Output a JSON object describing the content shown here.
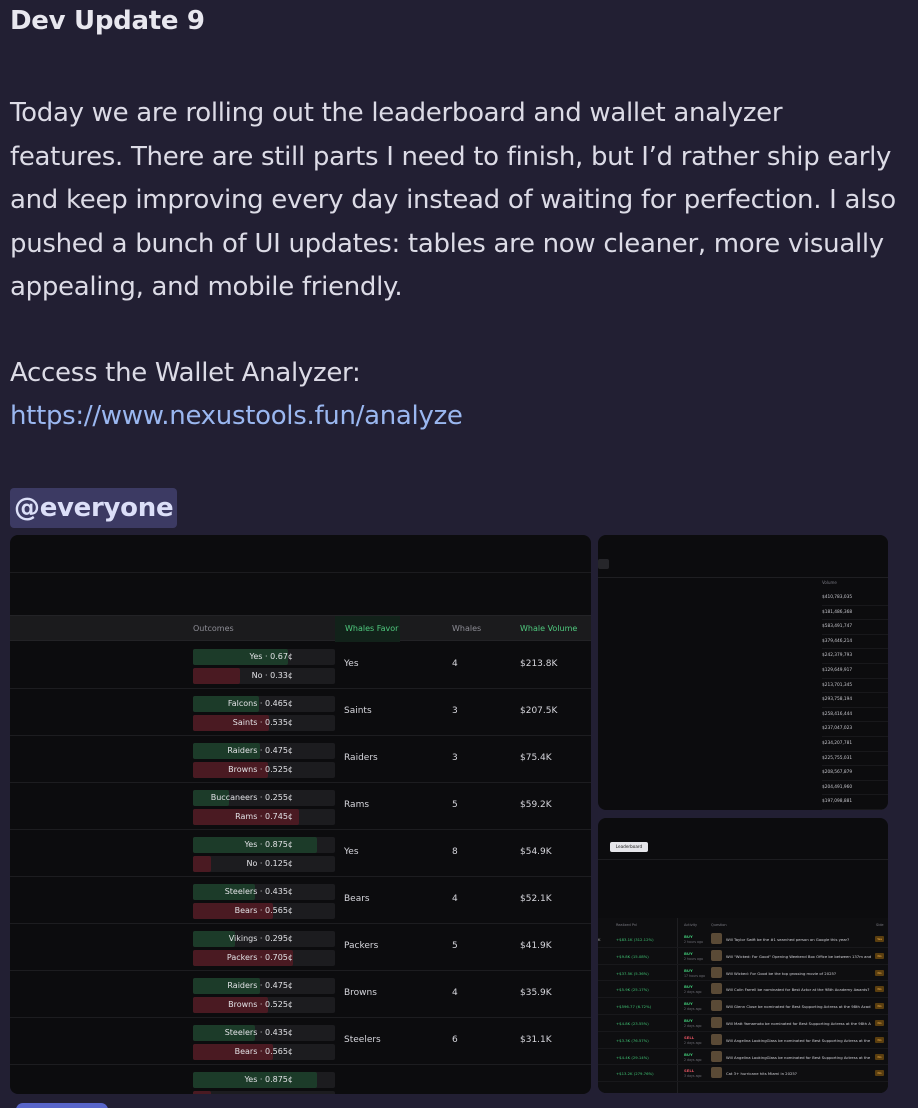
{
  "post": {
    "title": "Dev Update 9",
    "body": "Today we are rolling out the leaderboard and wallet analyzer features. There are still parts I need to finish, but I’d rather ship early and keep improving every day instead of waiting for perfection. I also pushed a bunch of UI updates: tables are now cleaner, more visually appealing, and mobile friendly.",
    "access_label": "Access the Wallet Analyzer:",
    "link": "https://www.nexustools.fun/analyze",
    "mention": "@everyone"
  },
  "colors": {
    "background": "#221f33",
    "link": "#9ab7f0",
    "mention_bg": "#3c3a63",
    "positive": "#4fc97e",
    "negative": "#e0525f"
  },
  "main_table": {
    "headers": {
      "outcomes": "Outcomes",
      "whales_favor": "Whales Favor",
      "whales": "Whales",
      "whale_volume": "Whale Volume"
    },
    "rows": [
      {
        "yes_label": "Yes · 0.67¢",
        "yes_share": 0.67,
        "no_label": "No · 0.33¢",
        "no_share": 0.33,
        "favor": "Yes",
        "whales": "4",
        "volume": "$213.8K"
      },
      {
        "yes_label": "Falcons · 0.465¢",
        "yes_share": 0.465,
        "no_label": "Saints · 0.535¢",
        "no_share": 0.535,
        "favor": "Saints",
        "whales": "3",
        "volume": "$207.5K"
      },
      {
        "yes_label": "Raiders · 0.475¢",
        "yes_share": 0.475,
        "no_label": "Browns · 0.525¢",
        "no_share": 0.525,
        "favor": "Raiders",
        "whales": "3",
        "volume": "$75.4K"
      },
      {
        "yes_label": "Buccaneers · 0.255¢",
        "yes_share": 0.255,
        "no_label": "Rams · 0.745¢",
        "no_share": 0.745,
        "favor": "Rams",
        "whales": "5",
        "volume": "$59.2K"
      },
      {
        "yes_label": "Yes · 0.875¢",
        "yes_share": 0.875,
        "no_label": "No · 0.125¢",
        "no_share": 0.125,
        "favor": "Yes",
        "whales": "8",
        "volume": "$54.9K"
      },
      {
        "yes_label": "Steelers · 0.435¢",
        "yes_share": 0.435,
        "no_label": "Bears · 0.565¢",
        "no_share": 0.565,
        "favor": "Bears",
        "whales": "4",
        "volume": "$52.1K"
      },
      {
        "yes_label": "Vikings · 0.295¢",
        "yes_share": 0.295,
        "no_label": "Packers · 0.705¢",
        "no_share": 0.705,
        "favor": "Packers",
        "whales": "5",
        "volume": "$41.9K"
      },
      {
        "yes_label": "Raiders · 0.475¢",
        "yes_share": 0.475,
        "no_label": "Browns · 0.525¢",
        "no_share": 0.525,
        "favor": "Browns",
        "whales": "4",
        "volume": "$35.9K"
      },
      {
        "yes_label": "Steelers · 0.435¢",
        "yes_share": 0.435,
        "no_label": "Bears · 0.565¢",
        "no_share": 0.565,
        "favor": "Steelers",
        "whales": "6",
        "volume": "$31.1K"
      },
      {
        "yes_label": "Yes · 0.875¢",
        "yes_share": 0.875,
        "no_label": "",
        "no_share": 0.125,
        "favor": "",
        "whales": "",
        "volume": ""
      }
    ]
  },
  "volume_table": {
    "header": "Volume",
    "values": [
      "$410,783,035",
      "$181,486,368",
      "$583,491,747",
      "$379,446,214",
      "$242,379,793",
      "$129,649,917",
      "$213,701,345",
      "$293,758,194",
      "$258,416,444",
      "$237,047,023",
      "$234,207,781",
      "$225,755,031",
      "$208,567,879",
      "$204,491,960",
      "$197,098,881"
    ]
  },
  "leaderboard": {
    "button": "Leaderboard",
    "headers": {
      "realized_pnl": "Realized Pnl",
      "activity": "Activity",
      "question": "Question",
      "side": "Side"
    },
    "rows": [
      {
        "key": "K",
        "pnl": "+$83.1K (312.12%)",
        "side": "BUY",
        "ago": "2 hours ago",
        "question": "Will Taylor Swift be the #1 searched person on Google this year?",
        "outcome": "Yes"
      },
      {
        "key": "",
        "pnl": "+$9.8K (15.08%)",
        "side": "BUY",
        "ago": "2 hours ago",
        "question": "Will \"Wicked: For Good\" Opening Weekend Box Office be between 137m and",
        "outcome": "No"
      },
      {
        "key": "",
        "pnl": "+$37.5K (5.36%)",
        "side": "BUY",
        "ago": "17 hours ago",
        "question": "Will Wicked: For Good be the top grossing movie of 2025?",
        "outcome": "No"
      },
      {
        "key": "",
        "pnl": "+$5.9K (25.17%)",
        "side": "BUY",
        "ago": "2 days ago",
        "question": "Will Colin Farrell be nominated for Best Actor at the 98th Academy Awards?",
        "outcome": "No"
      },
      {
        "key": "",
        "pnl": "+$596.77 (6.72%)",
        "side": "BUY",
        "ago": "2 days ago",
        "question": "Will Glenn Close be nominated for Best Supporting Actress at the 98th Acad",
        "outcome": "No"
      },
      {
        "key": "",
        "pnl": "+$4.8K (23.55%)",
        "side": "BUY",
        "ago": "2 days ago",
        "question": "Will Matt Yamamoto be nominated for Best Supporting Actress at the 98th A",
        "outcome": "No"
      },
      {
        "key": "",
        "pnl": "+$3.3K (76.57%)",
        "side": "SELL",
        "ago": "2 days ago",
        "question": "Will Angelina LookingGlass be nominated for Best Supporting Actress at the",
        "outcome": "No"
      },
      {
        "key": "",
        "pnl": "+$4.4K (29.14%)",
        "side": "BUY",
        "ago": "2 days ago",
        "question": "Will Angelina LookingGlass be nominated for Best Supporting Actress at the",
        "outcome": "No"
      },
      {
        "key": "",
        "pnl": "+$13.2K (279.76%)",
        "side": "SELL",
        "ago": "3 days ago",
        "question": "Cat 3+ hurricane hits Miami in 2025?",
        "outcome": "No"
      }
    ]
  }
}
